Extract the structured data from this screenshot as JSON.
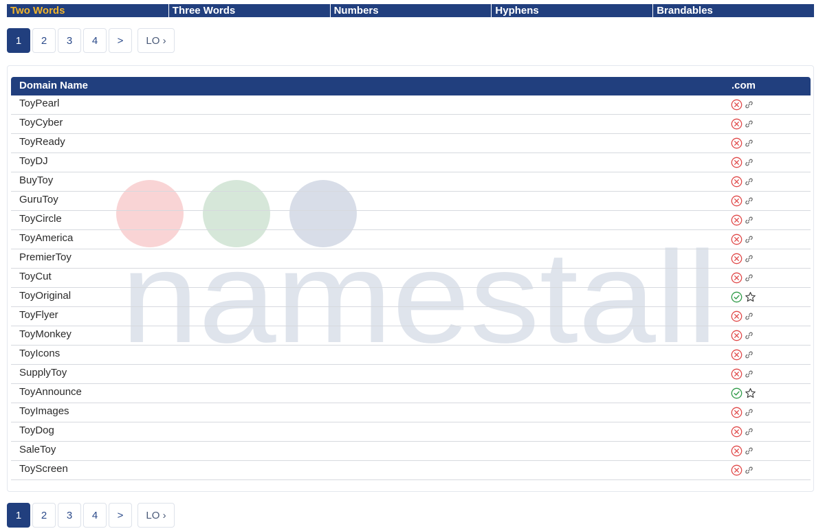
{
  "tabs": [
    {
      "label": "Two Words",
      "active": true
    },
    {
      "label": "Three Words",
      "active": false
    },
    {
      "label": "Numbers",
      "active": false
    },
    {
      "label": "Hyphens",
      "active": false
    },
    {
      "label": "Brandables",
      "active": false
    }
  ],
  "pagination": {
    "pages": [
      "1",
      "2",
      "3",
      "4"
    ],
    "current": "1",
    "next_label": ">",
    "lo_label": "LO ›"
  },
  "watermark": {
    "text": "namestall",
    "dot_colors": [
      "#f9d4d5",
      "#d6e7d9",
      "#d8dde8"
    ],
    "text_color": "#dfe4ec"
  },
  "colors": {
    "nav_bg": "#213f7e",
    "active_tab": "#f3b52a",
    "taken": "#e04848",
    "available": "#2e9a47"
  },
  "table": {
    "col_name": "Domain Name",
    "col_com": ".com",
    "rows": [
      {
        "name": "ToyPearl",
        "status": "taken",
        "action": "link-icon"
      },
      {
        "name": "ToyCyber",
        "status": "taken",
        "action": "link-icon"
      },
      {
        "name": "ToyReady",
        "status": "taken",
        "action": "link-icon"
      },
      {
        "name": "ToyDJ",
        "status": "taken",
        "action": "link-icon"
      },
      {
        "name": "BuyToy",
        "status": "taken",
        "action": "link-icon"
      },
      {
        "name": "GuruToy",
        "status": "taken",
        "action": "link-icon"
      },
      {
        "name": "ToyCircle",
        "status": "taken",
        "action": "link-icon"
      },
      {
        "name": "ToyAmerica",
        "status": "taken",
        "action": "link-icon"
      },
      {
        "name": "PremierToy",
        "status": "taken",
        "action": "link-icon"
      },
      {
        "name": "ToyCut",
        "status": "taken",
        "action": "link-icon"
      },
      {
        "name": "ToyOriginal",
        "status": "available",
        "action": "star-icon"
      },
      {
        "name": "ToyFlyer",
        "status": "taken",
        "action": "link-icon"
      },
      {
        "name": "ToyMonkey",
        "status": "taken",
        "action": "link-icon"
      },
      {
        "name": "ToyIcons",
        "status": "taken",
        "action": "link-icon"
      },
      {
        "name": "SupplyToy",
        "status": "taken",
        "action": "link-icon"
      },
      {
        "name": "ToyAnnounce",
        "status": "available",
        "action": "star-icon"
      },
      {
        "name": "ToyImages",
        "status": "taken",
        "action": "link-icon"
      },
      {
        "name": "ToyDog",
        "status": "taken",
        "action": "link-icon"
      },
      {
        "name": "SaleToy",
        "status": "taken",
        "action": "link-icon"
      },
      {
        "name": "ToyScreen",
        "status": "taken",
        "action": "link-icon"
      }
    ]
  }
}
